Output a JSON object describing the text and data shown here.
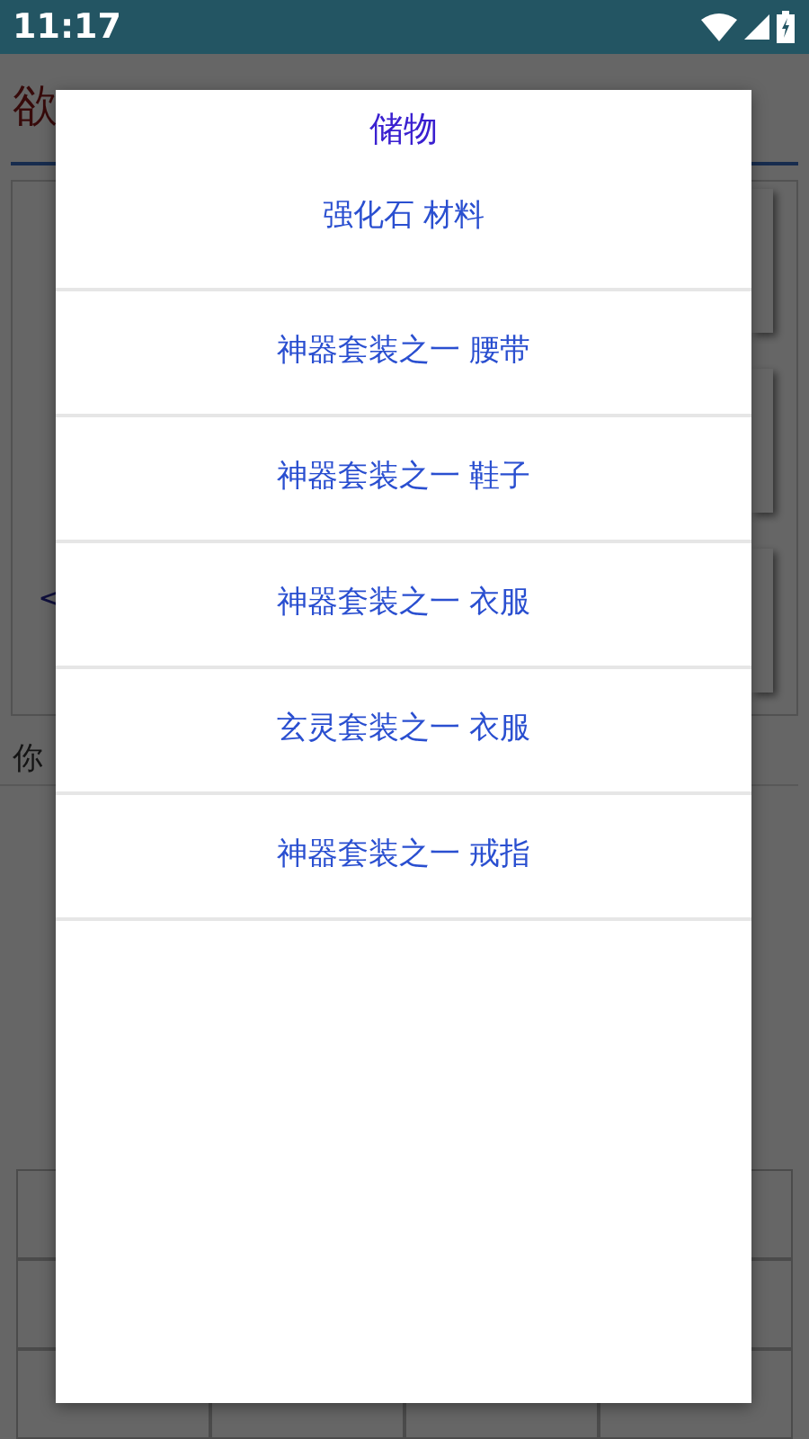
{
  "status_bar": {
    "time": "11:17"
  },
  "background": {
    "title": "欲",
    "prompt": "<",
    "footer": "你"
  },
  "dialog": {
    "title": "储物",
    "items": [
      {
        "label": "强化石 材料"
      },
      {
        "label": "神器套装之一 腰带"
      },
      {
        "label": "神器套装之一 鞋子"
      },
      {
        "label": "神器套装之一 衣服"
      },
      {
        "label": "玄灵套装之一 衣服"
      },
      {
        "label": "神器套装之一 戒指"
      }
    ]
  }
}
